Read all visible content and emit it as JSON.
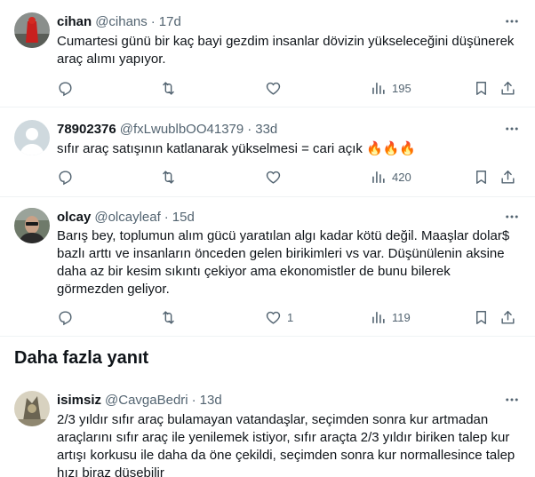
{
  "tweets": [
    {
      "name": "cihan",
      "handle": "@cihans",
      "time": "17d",
      "text": "Cumartesi günü bir kaç bayi gezdim insanlar dövizin yükseleceğini düşünerek araç alımı yapıyor.",
      "views": "195",
      "likes": "",
      "replies": "",
      "retweets": ""
    },
    {
      "name": "78902376",
      "handle": "@fxLwublbOO41379",
      "time": "33d",
      "text": "sıfır araç satışının katlanarak yükselmesi = cari açık",
      "emoji": "🔥🔥🔥",
      "views": "420",
      "likes": "",
      "replies": "",
      "retweets": ""
    },
    {
      "name": "olcay",
      "handle": "@olcayleaf",
      "time": "15d",
      "text": "Barış bey, toplumun alım gücü yaratılan algı kadar kötü değil. Maaşlar dolar$ bazlı arttı ve insanların önceden gelen birikimleri vs var. Düşünülenin aksine daha az bir kesim sıkıntı çekiyor ama ekonomistler de bunu bilerek görmezden geliyor.",
      "views": "119",
      "likes": "1",
      "replies": "",
      "retweets": ""
    },
    {
      "name": "isimsiz",
      "handle": "@CavgaBedri",
      "time": "13d",
      "text": "2/3 yıldır sıfır araç bulamayan vatandaşlar, seçimden sonra kur artmadan araçlarını sıfır araç ile yenilemek istiyor, sıfır araçta 2/3 yıldır biriken talep kur artışı korkusu ile daha da öne çekildi, seçimden sonra kur normallesince talep hızı biraz düşebilir"
    }
  ],
  "section": {
    "title": "Daha fazla yanıt"
  },
  "separator": "·",
  "icons": {
    "more": "more-horizontal-icon",
    "reply": "reply-icon",
    "retweet": "retweet-icon",
    "like": "heart-icon",
    "views": "views-icon",
    "bookmark": "bookmark-icon",
    "share": "share-icon"
  },
  "colors": {
    "text": "#0f1419",
    "secondary": "#536471",
    "border": "#eff3f4"
  }
}
